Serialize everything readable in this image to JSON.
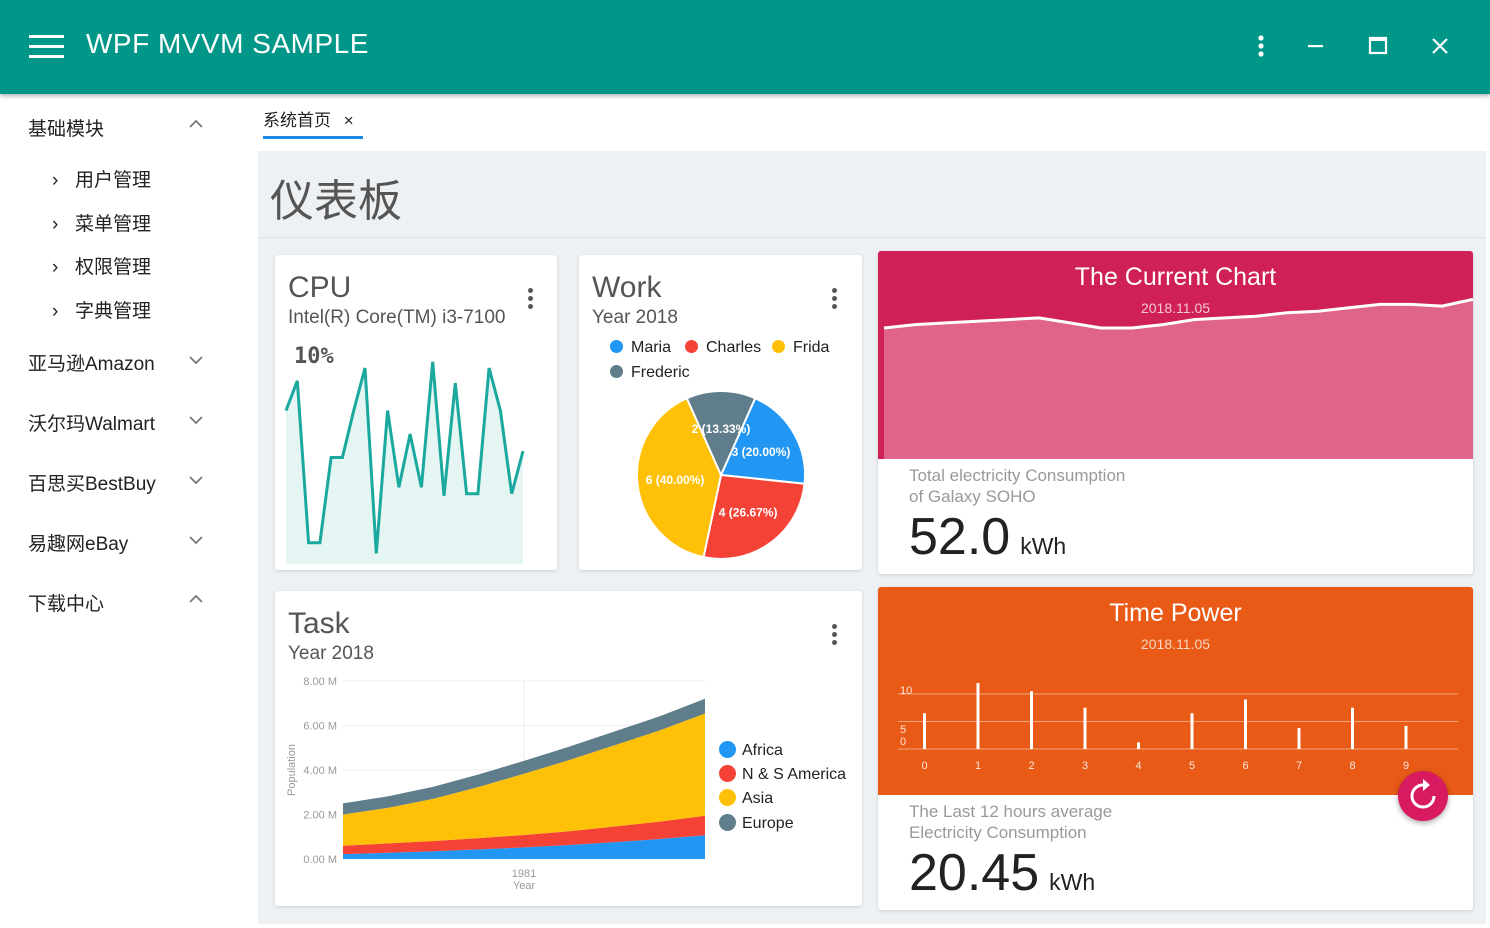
{
  "app": {
    "title": "WPF MVVM SAMPLE"
  },
  "window": {
    "menu_icon": "more-vert-icon",
    "minimize_icon": "minimize-icon",
    "maximize_icon": "maximize-icon",
    "close_icon": "close-icon"
  },
  "sidebar": {
    "groups": [
      {
        "label": "基础模块",
        "expanded": true,
        "items": [
          "用户管理",
          "菜单管理",
          "权限管理",
          "字典管理"
        ]
      },
      {
        "label": "亚马逊Amazon",
        "expanded": false
      },
      {
        "label": "沃尔玛Walmart",
        "expanded": false
      },
      {
        "label": "百思买BestBuy",
        "expanded": false
      },
      {
        "label": "易趣网eBay",
        "expanded": false
      },
      {
        "label": "下载中心",
        "expanded": true
      }
    ]
  },
  "tabs": [
    {
      "label": "系统首页",
      "close": "×",
      "active": true
    }
  ],
  "dashboard": {
    "title": "仪表板",
    "cpu": {
      "title": "CPU",
      "subtitle": "Intel(R) Core(TM) i3-7100",
      "value_label": "10%"
    },
    "work": {
      "title": "Work",
      "subtitle": "Year 2018"
    },
    "current": {
      "title": "The Current Chart",
      "date": "2018.11.05",
      "desc1": "Total electricity Consumption",
      "desc2": "of Galaxy SOHO",
      "value": "52.0",
      "unit": "kWh"
    },
    "task": {
      "title": "Task",
      "subtitle": "Year 2018"
    },
    "power": {
      "title": "Time Power",
      "date": "2018.11.05",
      "desc1": "The Last 12 hours average",
      "desc2": "Electricity Consumption",
      "value": "20.45",
      "unit": "kWh",
      "fab_icon": "refresh-icon"
    }
  },
  "chart_data": [
    {
      "id": "cpu",
      "type": "area",
      "ylim": [
        0,
        100
      ],
      "color": "#1ba89e",
      "values": [
        72,
        86,
        10,
        10,
        50,
        50,
        72,
        92,
        5,
        72,
        36,
        61,
        36,
        95,
        32,
        85,
        33,
        33,
        92,
        72,
        33,
        53
      ]
    },
    {
      "id": "work",
      "type": "pie",
      "series": [
        {
          "name": "Maria",
          "value": 3,
          "label": "3 (20.00%)",
          "color": "#2196f3"
        },
        {
          "name": "Charles",
          "value": 4,
          "label": "4 (26.67%)",
          "color": "#f44336"
        },
        {
          "name": "Frida",
          "value": 6,
          "label": "6 (40.00%)",
          "color": "#ffc107"
        },
        {
          "name": "Frederic",
          "value": 2,
          "label": "2 (13.33%)",
          "color": "#607d8b"
        }
      ]
    },
    {
      "id": "current",
      "type": "area",
      "ylim": [
        0,
        100
      ],
      "color": "#ffffff",
      "values": [
        78,
        80,
        81,
        82,
        83,
        84,
        81,
        78,
        78,
        80,
        83,
        84,
        85,
        87,
        88,
        90,
        92,
        92,
        91,
        95
      ]
    },
    {
      "id": "task",
      "type": "area",
      "stacked": true,
      "xlabel": "Year",
      "ylabel": "Population",
      "ylim": [
        0,
        8000000
      ],
      "yticks": [
        "0.00 M",
        "2.00 M",
        "4.00 M",
        "6.00 M",
        "8.00 M"
      ],
      "xtick": "1981",
      "x": [
        0,
        1,
        2,
        3,
        4,
        5,
        6,
        7,
        8
      ],
      "series": [
        {
          "name": "Africa",
          "color": "#2196f3",
          "values": [
            220000,
            280000,
            350000,
            430000,
            520000,
            630000,
            760000,
            900000,
            1070000
          ]
        },
        {
          "name": "N & S America",
          "color": "#f44336",
          "values": [
            380000,
            420000,
            460000,
            510000,
            560000,
            620000,
            700000,
            780000,
            870000
          ]
        },
        {
          "name": "Asia",
          "color": "#ffc107",
          "values": [
            1400000,
            1600000,
            1900000,
            2300000,
            2750000,
            3200000,
            3650000,
            4100000,
            4600000
          ]
        },
        {
          "name": "Europe",
          "color": "#607d8b",
          "values": [
            500000,
            520000,
            540000,
            560000,
            580000,
            600000,
            620000,
            640000,
            660000
          ]
        }
      ]
    },
    {
      "id": "power",
      "type": "bar",
      "ylim": [
        0,
        12
      ],
      "yticks": [
        "10",
        "5",
        "0"
      ],
      "categories": [
        "0",
        "1",
        "2",
        "3",
        "4",
        "5",
        "6",
        "7",
        "8",
        "9"
      ],
      "values": [
        6.5,
        12,
        10.5,
        7.5,
        1.2,
        6.5,
        9,
        3.8,
        7.5,
        4.2
      ]
    }
  ]
}
